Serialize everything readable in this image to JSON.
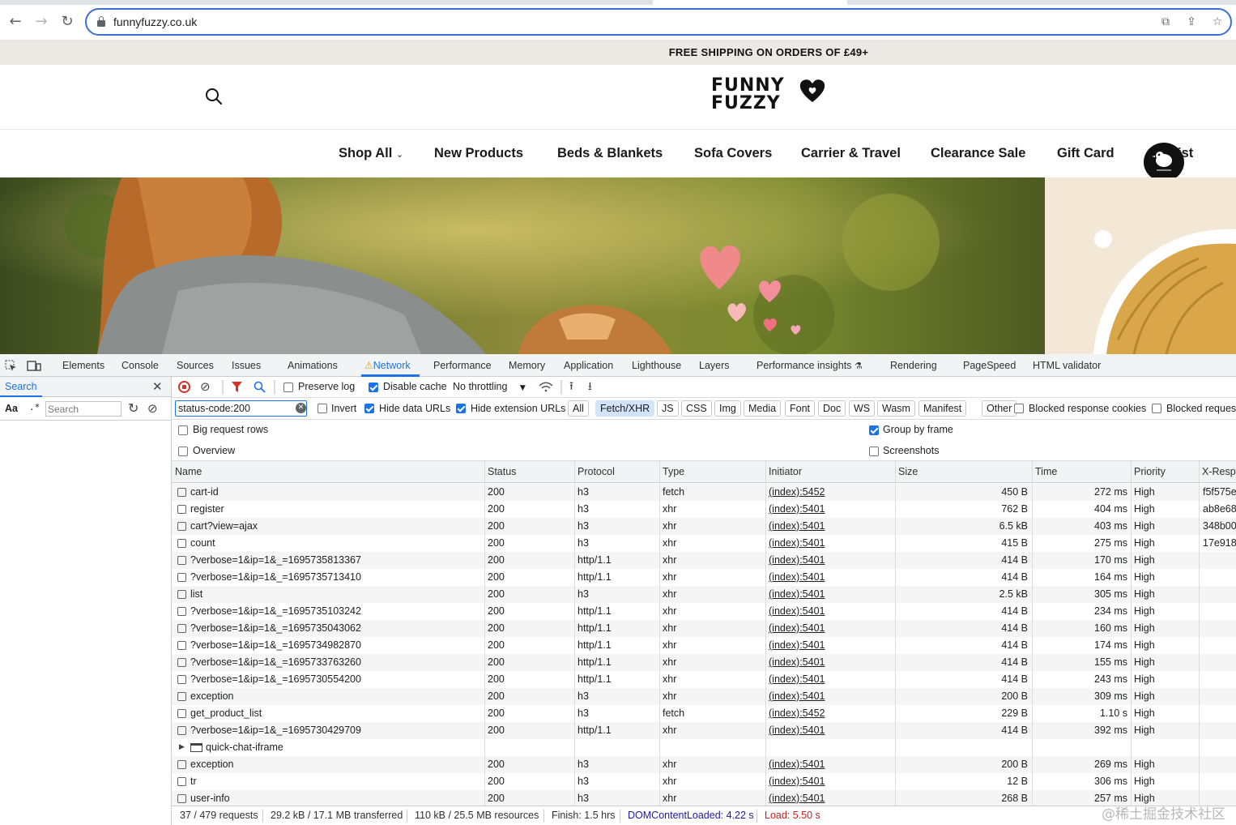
{
  "browser": {
    "url": "funnyfuzzy.co.uk",
    "icons": [
      "back-icon",
      "forward-icon",
      "reload-icon",
      "lock-icon",
      "translate-icon",
      "share-icon",
      "bookmark-star-icon"
    ]
  },
  "site": {
    "announcement": "FREE SHIPPING ON ORDERS OF £49+",
    "logo_line1": "FUNNY",
    "logo_line2": "FUZZY",
    "nav": [
      "Shop All",
      "New Products",
      "Beds & Blankets",
      "Sofa Covers",
      "Carrier & Travel",
      "Clearance Sale",
      "Gift Card",
      "ist"
    ]
  },
  "devtools": {
    "tabs": [
      "Elements",
      "Console",
      "Sources",
      "Issues",
      "Animations",
      "Network",
      "Performance",
      "Memory",
      "Application",
      "Lighthouse",
      "Layers",
      "Performance insights",
      "Rendering",
      "PageSpeed",
      "HTML validator"
    ],
    "left_panel": {
      "tab": "Search",
      "case_label": "Aa",
      "regex_label": ".*",
      "placeholder": "Search"
    },
    "toolbar": {
      "preserve_log": "Preserve log",
      "disable_cache": "Disable cache",
      "throttling": "No throttling"
    },
    "filter": {
      "value": "status-code:200",
      "invert": "Invert",
      "hide_data_urls": "Hide data URLs",
      "hide_extension_urls": "Hide extension URLs",
      "types": [
        "All",
        "Fetch/XHR",
        "JS",
        "CSS",
        "Img",
        "Media",
        "Font",
        "Doc",
        "WS",
        "Wasm",
        "Manifest",
        "Other"
      ],
      "active_type": "Fetch/XHR",
      "blocked_cookies": "Blocked response cookies",
      "blocked_requests": "Blocked request"
    },
    "options": {
      "big_rows": "Big request rows",
      "overview": "Overview",
      "group_by_frame": "Group by frame",
      "screenshots": "Screenshots"
    },
    "columns": [
      "Name",
      "Status",
      "Protocol",
      "Type",
      "Initiator",
      "Size",
      "Time",
      "Priority",
      "X-Resp"
    ],
    "rows": [
      {
        "name": "cart-id",
        "status": "200",
        "protocol": "h3",
        "type": "fetch",
        "initiator": "(index):5452",
        "size": "450 B",
        "time": "272 ms",
        "priority": "High",
        "xresp": "f5f575e"
      },
      {
        "name": "register",
        "status": "200",
        "protocol": "h3",
        "type": "xhr",
        "initiator": "(index):5401",
        "size": "762 B",
        "time": "404 ms",
        "priority": "High",
        "xresp": "ab8e68"
      },
      {
        "name": "cart?view=ajax",
        "status": "200",
        "protocol": "h3",
        "type": "xhr",
        "initiator": "(index):5401",
        "size": "6.5 kB",
        "time": "403 ms",
        "priority": "High",
        "xresp": "348b00"
      },
      {
        "name": "count",
        "status": "200",
        "protocol": "h3",
        "type": "xhr",
        "initiator": "(index):5401",
        "size": "415 B",
        "time": "275 ms",
        "priority": "High",
        "xresp": "17e918"
      },
      {
        "name": "?verbose=1&ip=1&_=1695735813367",
        "status": "200",
        "protocol": "http/1.1",
        "type": "xhr",
        "initiator": "(index):5401",
        "size": "414 B",
        "time": "170 ms",
        "priority": "High",
        "xresp": ""
      },
      {
        "name": "?verbose=1&ip=1&_=1695735713410",
        "status": "200",
        "protocol": "http/1.1",
        "type": "xhr",
        "initiator": "(index):5401",
        "size": "414 B",
        "time": "164 ms",
        "priority": "High",
        "xresp": ""
      },
      {
        "name": "list",
        "status": "200",
        "protocol": "h3",
        "type": "xhr",
        "initiator": "(index):5401",
        "size": "2.5 kB",
        "time": "305 ms",
        "priority": "High",
        "xresp": ""
      },
      {
        "name": "?verbose=1&ip=1&_=1695735103242",
        "status": "200",
        "protocol": "http/1.1",
        "type": "xhr",
        "initiator": "(index):5401",
        "size": "414 B",
        "time": "234 ms",
        "priority": "High",
        "xresp": ""
      },
      {
        "name": "?verbose=1&ip=1&_=1695735043062",
        "status": "200",
        "protocol": "http/1.1",
        "type": "xhr",
        "initiator": "(index):5401",
        "size": "414 B",
        "time": "160 ms",
        "priority": "High",
        "xresp": ""
      },
      {
        "name": "?verbose=1&ip=1&_=1695734982870",
        "status": "200",
        "protocol": "http/1.1",
        "type": "xhr",
        "initiator": "(index):5401",
        "size": "414 B",
        "time": "174 ms",
        "priority": "High",
        "xresp": ""
      },
      {
        "name": "?verbose=1&ip=1&_=1695733763260",
        "status": "200",
        "protocol": "http/1.1",
        "type": "xhr",
        "initiator": "(index):5401",
        "size": "414 B",
        "time": "155 ms",
        "priority": "High",
        "xresp": ""
      },
      {
        "name": "?verbose=1&ip=1&_=1695730554200",
        "status": "200",
        "protocol": "http/1.1",
        "type": "xhr",
        "initiator": "(index):5401",
        "size": "414 B",
        "time": "243 ms",
        "priority": "High",
        "xresp": ""
      },
      {
        "name": "exception",
        "status": "200",
        "protocol": "h3",
        "type": "xhr",
        "initiator": "(index):5401",
        "size": "200 B",
        "time": "309 ms",
        "priority": "High",
        "xresp": ""
      },
      {
        "name": "get_product_list",
        "status": "200",
        "protocol": "h3",
        "type": "fetch",
        "initiator": "(index):5452",
        "size": "229 B",
        "time": "1.10 s",
        "priority": "High",
        "xresp": ""
      },
      {
        "name": "?verbose=1&ip=1&_=1695730429709",
        "status": "200",
        "protocol": "http/1.1",
        "type": "xhr",
        "initiator": "(index):5401",
        "size": "414 B",
        "time": "392 ms",
        "priority": "High",
        "xresp": ""
      },
      {
        "name": "quick-chat-iframe",
        "frame": true,
        "status": "",
        "protocol": "",
        "type": "",
        "initiator": "",
        "size": "",
        "time": "",
        "priority": "",
        "xresp": ""
      },
      {
        "name": "exception",
        "status": "200",
        "protocol": "h3",
        "type": "xhr",
        "initiator": "(index):5401",
        "size": "200 B",
        "time": "269 ms",
        "priority": "High",
        "xresp": ""
      },
      {
        "name": "tr",
        "status": "200",
        "protocol": "h3",
        "type": "xhr",
        "initiator": "(index):5401",
        "size": "12 B",
        "time": "306 ms",
        "priority": "High",
        "xresp": ""
      },
      {
        "name": "user-info",
        "status": "200",
        "protocol": "h3",
        "type": "xhr",
        "initiator": "(index):5401",
        "size": "268 B",
        "time": "257 ms",
        "priority": "High",
        "xresp": ""
      }
    ],
    "status": {
      "requests": "37 / 479 requests",
      "transferred": "29.2 kB / 17.1 MB transferred",
      "resources": "110 kB / 25.5 MB resources",
      "finish": "Finish: 1.5 hrs",
      "dom_content_loaded": "DOMContentLoaded: 4.22 s",
      "load": "Load: 5.50 s"
    },
    "colors": {
      "accent": "#1a73e8",
      "dcl": "#1a1aa6",
      "load": "#c5221f",
      "record": "#d93025"
    }
  },
  "watermark": "@稀土掘金技术社区"
}
